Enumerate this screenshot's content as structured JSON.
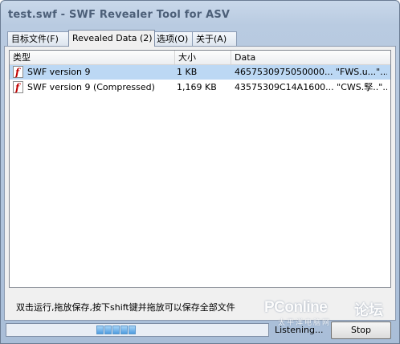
{
  "window": {
    "title": "test.swf - SWF Revealer Tool for ASV"
  },
  "tabs": [
    {
      "label": "目标文件(F)"
    },
    {
      "label": "Revealed Data (2)"
    },
    {
      "label": "选项(O)"
    },
    {
      "label": "关于(A)"
    }
  ],
  "table": {
    "columns": [
      "类型",
      "大小",
      "Data"
    ],
    "rows": [
      {
        "type": "SWF version 9",
        "size": "1 KB",
        "data": "4657530975050000... \"FWS.u...\"..."
      },
      {
        "type": "SWF version 9 (Compressed)",
        "size": "1,169 KB",
        "data": "43575309C14A1600... \"CWS.孯..\"..."
      }
    ]
  },
  "hint": "双击运行,拖放保存,按下shift键并拖放可以保存全部文件",
  "status": {
    "text": "Listening...",
    "stop_label": "Stop"
  },
  "watermark": {
    "brand": "PConline",
    "forum": "论坛",
    "sub": "太平洋电脑网"
  },
  "colors": {
    "selection": "#bcd8f4",
    "titlebar": "#b9cbe1"
  }
}
